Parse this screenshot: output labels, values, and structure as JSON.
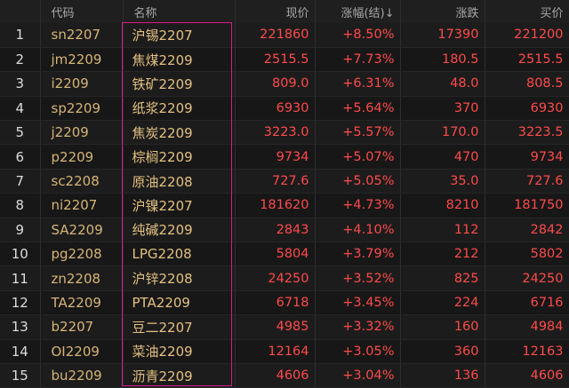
{
  "columns": {
    "code": "代码",
    "name": "名称",
    "price": "现价",
    "change_pct": "涨幅(结)↓",
    "change": "涨跌",
    "bid": "买价"
  },
  "colors": {
    "up": "#ff4a4a",
    "name_text": "#e3c180",
    "highlight_box": "#d81b8c"
  },
  "rows": [
    {
      "idx": "1",
      "code": "sn2207",
      "name": "沪锡2207",
      "price": "221860",
      "change_pct": "+8.50%",
      "change": "17390",
      "bid": "221200"
    },
    {
      "idx": "2",
      "code": "jm2209",
      "name": "焦煤2209",
      "price": "2515.5",
      "change_pct": "+7.73%",
      "change": "180.5",
      "bid": "2515.5"
    },
    {
      "idx": "3",
      "code": "i2209",
      "name": "铁矿2209",
      "price": "809.0",
      "change_pct": "+6.31%",
      "change": "48.0",
      "bid": "808.5"
    },
    {
      "idx": "4",
      "code": "sp2209",
      "name": "纸浆2209",
      "price": "6930",
      "change_pct": "+5.64%",
      "change": "370",
      "bid": "6930"
    },
    {
      "idx": "5",
      "code": "j2209",
      "name": "焦炭2209",
      "price": "3223.0",
      "change_pct": "+5.57%",
      "change": "170.0",
      "bid": "3223.5"
    },
    {
      "idx": "6",
      "code": "p2209",
      "name": "棕榈2209",
      "price": "9734",
      "change_pct": "+5.07%",
      "change": "470",
      "bid": "9734"
    },
    {
      "idx": "7",
      "code": "sc2208",
      "name": "原油2208",
      "price": "727.6",
      "change_pct": "+5.05%",
      "change": "35.0",
      "bid": "727.6"
    },
    {
      "idx": "8",
      "code": "ni2207",
      "name": "沪镍2207",
      "price": "181620",
      "change_pct": "+4.73%",
      "change": "8210",
      "bid": "181750"
    },
    {
      "idx": "9",
      "code": "SA2209",
      "name": "纯碱2209",
      "price": "2843",
      "change_pct": "+4.10%",
      "change": "112",
      "bid": "2842"
    },
    {
      "idx": "10",
      "code": "pg2208",
      "name": "LPG2208",
      "price": "5804",
      "change_pct": "+3.79%",
      "change": "212",
      "bid": "5802"
    },
    {
      "idx": "11",
      "code": "zn2208",
      "name": "沪锌2208",
      "price": "24250",
      "change_pct": "+3.52%",
      "change": "825",
      "bid": "24250"
    },
    {
      "idx": "12",
      "code": "TA2209",
      "name": "PTA2209",
      "price": "6718",
      "change_pct": "+3.45%",
      "change": "224",
      "bid": "6716"
    },
    {
      "idx": "13",
      "code": "b2207",
      "name": "豆二2207",
      "price": "4985",
      "change_pct": "+3.32%",
      "change": "160",
      "bid": "4984"
    },
    {
      "idx": "14",
      "code": "OI2209",
      "name": "菜油2209",
      "price": "12164",
      "change_pct": "+3.05%",
      "change": "360",
      "bid": "12163"
    },
    {
      "idx": "15",
      "code": "bu2209",
      "name": "沥青2209",
      "price": "4606",
      "change_pct": "+3.04%",
      "change": "136",
      "bid": "4606"
    }
  ]
}
